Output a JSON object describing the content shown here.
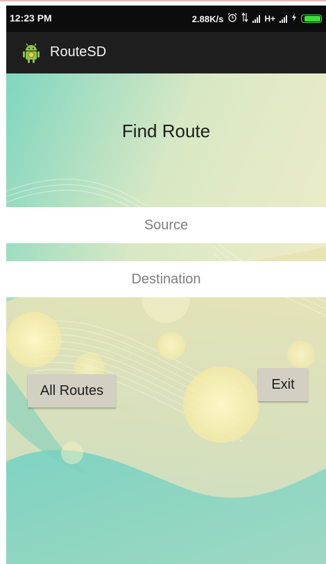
{
  "status_bar": {
    "time": "12:23 PM",
    "speed": "2.88K/s",
    "network": "H+",
    "icons": [
      "alarm-icon",
      "data-transfer-icon",
      "signal-icon",
      "signal-icon-2",
      "charging-icon",
      "battery-icon"
    ]
  },
  "action_bar": {
    "title": "RouteSD",
    "icon": "android-app-icon"
  },
  "main": {
    "heading": "Find Route",
    "source_placeholder": "Source",
    "destination_placeholder": "Destination",
    "all_routes_label": "All Routes",
    "exit_label": "Exit"
  },
  "colors": {
    "status_bar": "#0c0c0c",
    "action_bar": "#1e1e1e",
    "background_teal": "#7fd6c0",
    "background_cream": "#f2ecc8",
    "button": "#d3d0c3",
    "battery": "#3ddc3d"
  }
}
